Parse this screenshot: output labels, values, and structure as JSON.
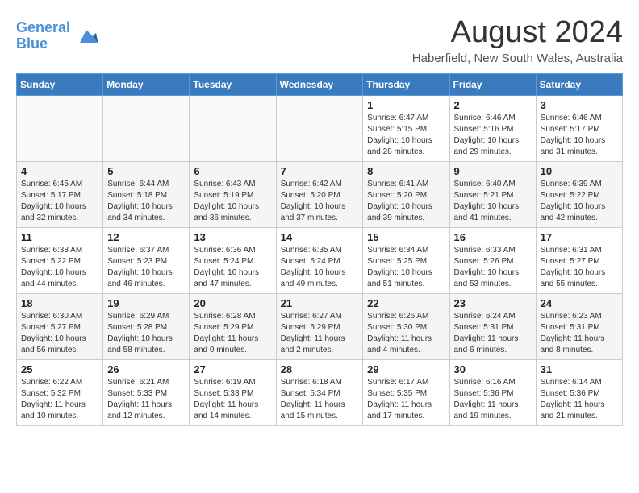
{
  "header": {
    "logo_line1": "General",
    "logo_line2": "Blue",
    "month_title": "August 2024",
    "location": "Haberfield, New South Wales, Australia"
  },
  "weekdays": [
    "Sunday",
    "Monday",
    "Tuesday",
    "Wednesday",
    "Thursday",
    "Friday",
    "Saturday"
  ],
  "weeks": [
    [
      {
        "day": "",
        "info": ""
      },
      {
        "day": "",
        "info": ""
      },
      {
        "day": "",
        "info": ""
      },
      {
        "day": "",
        "info": ""
      },
      {
        "day": "1",
        "info": "Sunrise: 6:47 AM\nSunset: 5:15 PM\nDaylight: 10 hours\nand 28 minutes."
      },
      {
        "day": "2",
        "info": "Sunrise: 6:46 AM\nSunset: 5:16 PM\nDaylight: 10 hours\nand 29 minutes."
      },
      {
        "day": "3",
        "info": "Sunrise: 6:46 AM\nSunset: 5:17 PM\nDaylight: 10 hours\nand 31 minutes."
      }
    ],
    [
      {
        "day": "4",
        "info": "Sunrise: 6:45 AM\nSunset: 5:17 PM\nDaylight: 10 hours\nand 32 minutes."
      },
      {
        "day": "5",
        "info": "Sunrise: 6:44 AM\nSunset: 5:18 PM\nDaylight: 10 hours\nand 34 minutes."
      },
      {
        "day": "6",
        "info": "Sunrise: 6:43 AM\nSunset: 5:19 PM\nDaylight: 10 hours\nand 36 minutes."
      },
      {
        "day": "7",
        "info": "Sunrise: 6:42 AM\nSunset: 5:20 PM\nDaylight: 10 hours\nand 37 minutes."
      },
      {
        "day": "8",
        "info": "Sunrise: 6:41 AM\nSunset: 5:20 PM\nDaylight: 10 hours\nand 39 minutes."
      },
      {
        "day": "9",
        "info": "Sunrise: 6:40 AM\nSunset: 5:21 PM\nDaylight: 10 hours\nand 41 minutes."
      },
      {
        "day": "10",
        "info": "Sunrise: 6:39 AM\nSunset: 5:22 PM\nDaylight: 10 hours\nand 42 minutes."
      }
    ],
    [
      {
        "day": "11",
        "info": "Sunrise: 6:38 AM\nSunset: 5:22 PM\nDaylight: 10 hours\nand 44 minutes."
      },
      {
        "day": "12",
        "info": "Sunrise: 6:37 AM\nSunset: 5:23 PM\nDaylight: 10 hours\nand 46 minutes."
      },
      {
        "day": "13",
        "info": "Sunrise: 6:36 AM\nSunset: 5:24 PM\nDaylight: 10 hours\nand 47 minutes."
      },
      {
        "day": "14",
        "info": "Sunrise: 6:35 AM\nSunset: 5:24 PM\nDaylight: 10 hours\nand 49 minutes."
      },
      {
        "day": "15",
        "info": "Sunrise: 6:34 AM\nSunset: 5:25 PM\nDaylight: 10 hours\nand 51 minutes."
      },
      {
        "day": "16",
        "info": "Sunrise: 6:33 AM\nSunset: 5:26 PM\nDaylight: 10 hours\nand 53 minutes."
      },
      {
        "day": "17",
        "info": "Sunrise: 6:31 AM\nSunset: 5:27 PM\nDaylight: 10 hours\nand 55 minutes."
      }
    ],
    [
      {
        "day": "18",
        "info": "Sunrise: 6:30 AM\nSunset: 5:27 PM\nDaylight: 10 hours\nand 56 minutes."
      },
      {
        "day": "19",
        "info": "Sunrise: 6:29 AM\nSunset: 5:28 PM\nDaylight: 10 hours\nand 58 minutes."
      },
      {
        "day": "20",
        "info": "Sunrise: 6:28 AM\nSunset: 5:29 PM\nDaylight: 11 hours\nand 0 minutes."
      },
      {
        "day": "21",
        "info": "Sunrise: 6:27 AM\nSunset: 5:29 PM\nDaylight: 11 hours\nand 2 minutes."
      },
      {
        "day": "22",
        "info": "Sunrise: 6:26 AM\nSunset: 5:30 PM\nDaylight: 11 hours\nand 4 minutes."
      },
      {
        "day": "23",
        "info": "Sunrise: 6:24 AM\nSunset: 5:31 PM\nDaylight: 11 hours\nand 6 minutes."
      },
      {
        "day": "24",
        "info": "Sunrise: 6:23 AM\nSunset: 5:31 PM\nDaylight: 11 hours\nand 8 minutes."
      }
    ],
    [
      {
        "day": "25",
        "info": "Sunrise: 6:22 AM\nSunset: 5:32 PM\nDaylight: 11 hours\nand 10 minutes."
      },
      {
        "day": "26",
        "info": "Sunrise: 6:21 AM\nSunset: 5:33 PM\nDaylight: 11 hours\nand 12 minutes."
      },
      {
        "day": "27",
        "info": "Sunrise: 6:19 AM\nSunset: 5:33 PM\nDaylight: 11 hours\nand 14 minutes."
      },
      {
        "day": "28",
        "info": "Sunrise: 6:18 AM\nSunset: 5:34 PM\nDaylight: 11 hours\nand 15 minutes."
      },
      {
        "day": "29",
        "info": "Sunrise: 6:17 AM\nSunset: 5:35 PM\nDaylight: 11 hours\nand 17 minutes."
      },
      {
        "day": "30",
        "info": "Sunrise: 6:16 AM\nSunset: 5:36 PM\nDaylight: 11 hours\nand 19 minutes."
      },
      {
        "day": "31",
        "info": "Sunrise: 6:14 AM\nSunset: 5:36 PM\nDaylight: 11 hours\nand 21 minutes."
      }
    ]
  ]
}
